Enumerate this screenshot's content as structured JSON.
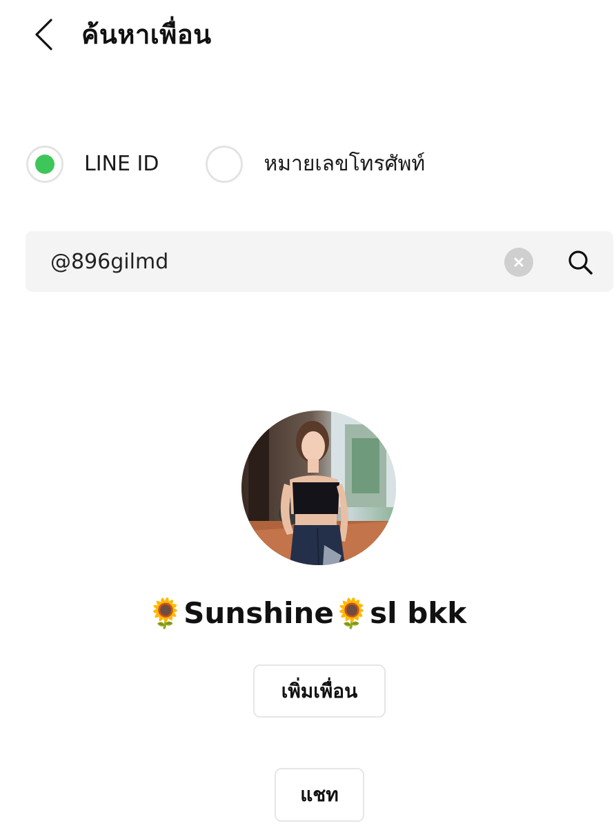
{
  "header": {
    "title": "ค้นหาเพื่อน",
    "back_icon": "chevron-left-icon"
  },
  "search_type": {
    "options": [
      {
        "label": "LINE ID",
        "selected": true
      },
      {
        "label": "หมายเลขโทรศัพท์",
        "selected": false
      }
    ],
    "selected_color": "#3fc65a"
  },
  "search": {
    "value": "@896gilmd",
    "clear_icon": "clear-icon",
    "search_icon": "search-icon"
  },
  "result": {
    "avatar": "profile-photo",
    "name": "🌻Sunshine🌻sl bkk",
    "add_friend_label": "เพิ่มเพื่อน",
    "chat_label": "แชท"
  }
}
